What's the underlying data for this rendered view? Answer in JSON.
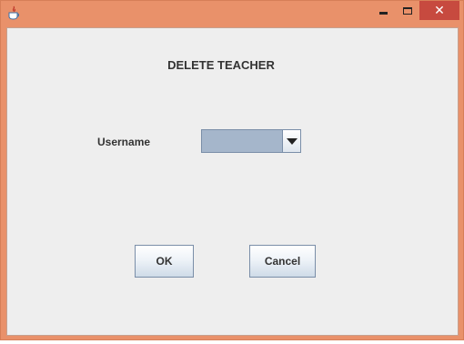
{
  "window": {
    "title": "",
    "frame_color": "#e9916a",
    "close_color": "#c74a3f",
    "controls": {
      "minimize_icon": "minimize-icon",
      "maximize_icon": "maximize-icon",
      "close_glyph": "✕"
    }
  },
  "dialog": {
    "heading": "DELETE TEACHER",
    "username_label": "Username",
    "username_selected": "",
    "ok_label": "OK",
    "cancel_label": "Cancel"
  }
}
